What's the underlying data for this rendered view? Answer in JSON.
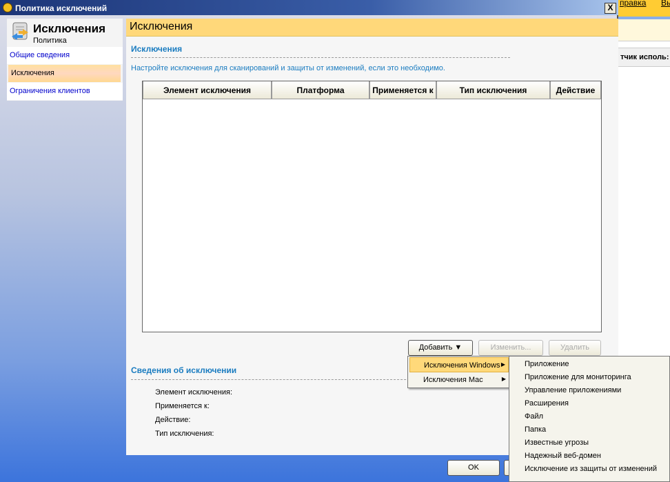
{
  "window": {
    "title": "Политика исключений",
    "close": "X"
  },
  "background_app": {
    "menu": [
      "правка",
      "Вы"
    ],
    "column_header": "тчик исполь:"
  },
  "sidebar": {
    "title": "Исключения",
    "subtitle": "Политика",
    "items": [
      {
        "label": "Общие сведения",
        "selected": false
      },
      {
        "label": "Исключения",
        "selected": true
      },
      {
        "label": "Ограничения клиентов",
        "selected": false
      }
    ]
  },
  "main": {
    "header": "Исключения",
    "section_title": "Исключения",
    "description": "Настройте исключения для сканирований и защиты от изменений, если это необходимо.",
    "table": {
      "columns": [
        "Элемент исключения",
        "Платформа",
        "Применяется к",
        "Тип исключения",
        "Действие"
      ],
      "rows": []
    },
    "buttons": {
      "add": "Добавить",
      "edit": "Изменить...",
      "delete": "Удалить"
    },
    "details": {
      "title": "Сведения об исключении",
      "labels": [
        "Элемент исключения:",
        "Применяется к:",
        "Действие:",
        "Тип исключения:"
      ]
    },
    "ok": "OK"
  },
  "add_menu": {
    "items": [
      {
        "label": "Исключения Windows",
        "highlighted": true
      },
      {
        "label": "Исключения Mac",
        "highlighted": false
      }
    ]
  },
  "submenu": {
    "items": [
      "Приложение",
      "Приложение для мониторинга",
      "Управление приложениями",
      "Расширения",
      "Файл",
      "Папка",
      "Известные угрозы",
      "Надежный веб-домен",
      "Исключение из защиты от изменений"
    ]
  },
  "colors": {
    "header_yellow": "#ffd87a",
    "link_blue": "#1a7cc0",
    "highlight": "#ffd97a"
  }
}
